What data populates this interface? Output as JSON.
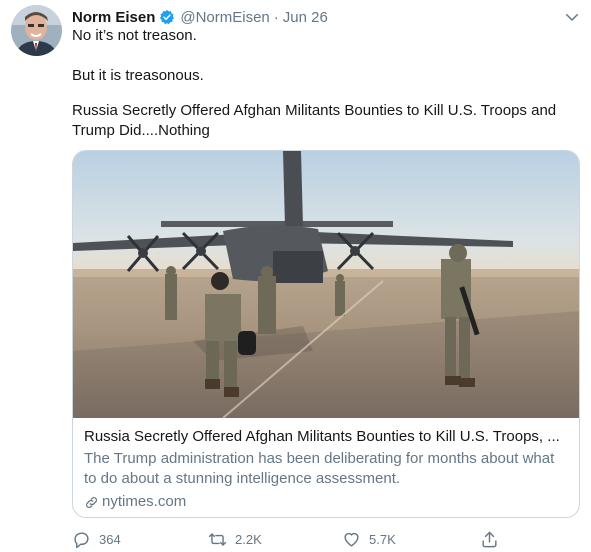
{
  "author": {
    "name": "Norm Eisen",
    "handle": "@NormEisen",
    "separator": "·",
    "date": "Jun 26"
  },
  "tweet": {
    "line1": "No it’s not treason.",
    "line2": "But it is treasonous.",
    "line3": "Russia Secretly Offered Afghan Militants Bounties to Kill U.S. Troops and Trump Did....Nothing"
  },
  "card": {
    "title": "Russia Secretly Offered Afghan Militants Bounties to Kill U.S. Troops, ...",
    "description": "The Trump administration has been deliberating for months about what to do about a stunning intelligence assessment.",
    "domain": "nytimes.com",
    "image_icon": "military-aircraft-photo"
  },
  "actions": {
    "replies": "364",
    "retweets": "2.2K",
    "likes": "5.7K"
  },
  "colors": {
    "text": "#14171a",
    "secondary": "#657786",
    "verified": "#1da1f2",
    "border": "#ccd6dd"
  }
}
